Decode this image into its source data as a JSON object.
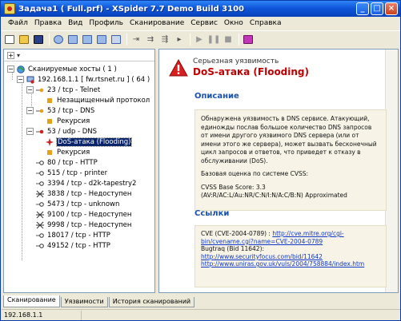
{
  "window": {
    "title": "Задача1 ( Full.prf) - XSpider 7.7 Demo Build 3100"
  },
  "menu": [
    "Файл",
    "Правка",
    "Вид",
    "Профиль",
    "Сканирование",
    "Сервис",
    "Окно",
    "Справка"
  ],
  "tree": {
    "root_label": "Сканируемые хосты ( 1 )",
    "host_label": "192.168.1.1 [ fw.rtsnet.ru ] ( 64 )",
    "items": [
      {
        "label": "23 / tcp - Telnet"
      },
      {
        "label": "Незащищенный протокол"
      },
      {
        "label": "53 / tcp - DNS"
      },
      {
        "label": "Рекурсия"
      },
      {
        "label": "53 / udp - DNS"
      },
      {
        "label": "DoS-атака (Flooding)"
      },
      {
        "label": "Рекурсия"
      },
      {
        "label": "80 / tcp - HTTP"
      },
      {
        "label": "515 / tcp - printer"
      },
      {
        "label": "3394 / tcp - d2k-tapestry2"
      },
      {
        "label": "3838 / tcp - Недоступен"
      },
      {
        "label": "5473 / tcp - unknown"
      },
      {
        "label": "9100 / tcp - Недоступен"
      },
      {
        "label": "9998 / tcp - Недоступен"
      },
      {
        "label": "18017 / tcp - HTTP"
      },
      {
        "label": "49152 / tcp - HTTP"
      }
    ]
  },
  "detail": {
    "category": "Серьезная уязвимость",
    "name": "DoS-атака (Flooding)",
    "description_title": "Описание",
    "description": "Обнаружена уязвимость в DNS сервисе. Атакующий, единожды послав большое количество DNS запросов от имени другого уязвимого DNS сервера (или от имени этого же сервера), может вызвать бесконечный цикл запросов и ответов, что приведет к отказу в обслуживании (DoS).",
    "cvss_intro": "Базовая оценка по системе CVSS:",
    "cvss_score": "CVSS Base Score: 3.3",
    "cvss_vector": "(AV:R/AC:L/Au:NR/C:N/I:N/A:C/B:N) Approximated",
    "links_title": "Ссылки",
    "cve_prefix": "CVE (CVE-2004-0789) : ",
    "cve_link": "http://cve.mitre.org/cgi-bin/cvename.cgi?name=CVE-2004-0789",
    "bugtraq_label": "Bugtraq (Bid 11642):",
    "link1": "http://www.securityfocus.com/bid/11642",
    "link2": "http://www.uniras.gov.uk/vuls/2004/758884/index.htm"
  },
  "tabs": [
    "Сканирование",
    "Уязвимости",
    "История сканирований"
  ],
  "status": {
    "text": "192.168.1.1"
  },
  "colors": {
    "title_bar": "#0b49c6",
    "vuln_red": "#c00000",
    "section_blue": "#1a52a8",
    "selection": "#0a246a"
  }
}
